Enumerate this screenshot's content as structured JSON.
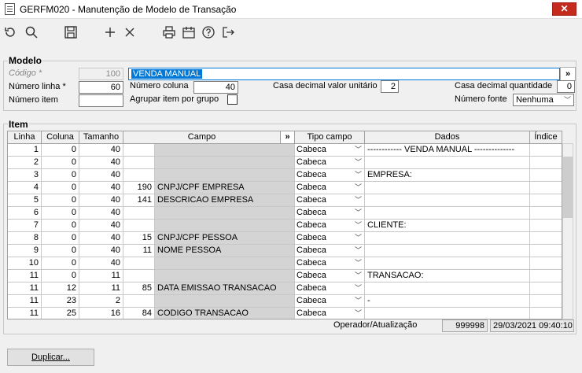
{
  "window": {
    "title": "GERFM020 - Manutenção de Modelo de Transação",
    "close_label": "✕"
  },
  "toolbar": {
    "icons": [
      "undo-icon",
      "search-icon",
      "save-icon",
      "add-icon",
      "delete-icon",
      "print-icon",
      "calendar-icon",
      "help-icon",
      "exit-icon"
    ]
  },
  "modelo": {
    "legend": "Modelo",
    "codigo_label": "Código *",
    "codigo_value": "100",
    "descricao_value": "VENDA MANUAL",
    "expand_label": "»",
    "numero_linha_label": "Número linha *",
    "numero_linha_value": "60",
    "numero_coluna_label": "Número coluna",
    "numero_coluna_value": "40",
    "casa_unitario_label": "Casa decimal valor unitário",
    "casa_unitario_value": "2",
    "casa_quantidade_label": "Casa decimal quantidade",
    "casa_quantidade_value": "0",
    "numero_item_label": "Número item",
    "numero_item_value": "",
    "agrupar_label": "Agrupar item por grupo",
    "agrupar_checked": false,
    "numero_fonte_label": "Número fonte",
    "numero_fonte_value": "Nenhuma"
  },
  "item": {
    "legend": "Item",
    "headers": {
      "linha": "Linha",
      "coluna": "Coluna",
      "tamanho": "Tamanho",
      "campo": "Campo",
      "expand": "»",
      "tipo": "Tipo campo",
      "dados": "Dados",
      "indice": "Índice"
    },
    "rows": [
      {
        "linha": "1",
        "coluna": "0",
        "tamanho": "40",
        "cod": "",
        "campo": "",
        "tipo": "Cabeca",
        "dados": "------------ VENDA MANUAL --------------",
        "indice": ""
      },
      {
        "linha": "2",
        "coluna": "0",
        "tamanho": "40",
        "cod": "",
        "campo": "",
        "tipo": "Cabeca",
        "dados": "",
        "indice": ""
      },
      {
        "linha": "3",
        "coluna": "0",
        "tamanho": "40",
        "cod": "",
        "campo": "",
        "tipo": "Cabeca",
        "dados": "EMPRESA:",
        "indice": ""
      },
      {
        "linha": "4",
        "coluna": "0",
        "tamanho": "40",
        "cod": "190",
        "campo": "CNPJ/CPF EMPRESA",
        "tipo": "Cabeca",
        "dados": "",
        "indice": ""
      },
      {
        "linha": "5",
        "coluna": "0",
        "tamanho": "40",
        "cod": "141",
        "campo": "DESCRICAO EMPRESA",
        "tipo": "Cabeca",
        "dados": "",
        "indice": ""
      },
      {
        "linha": "6",
        "coluna": "0",
        "tamanho": "40",
        "cod": "",
        "campo": "",
        "tipo": "Cabeca",
        "dados": "",
        "indice": ""
      },
      {
        "linha": "7",
        "coluna": "0",
        "tamanho": "40",
        "cod": "",
        "campo": "",
        "tipo": "Cabeca",
        "dados": "CLIENTE:",
        "indice": ""
      },
      {
        "linha": "8",
        "coluna": "0",
        "tamanho": "40",
        "cod": "15",
        "campo": "CNPJ/CPF PESSOA",
        "tipo": "Cabeca",
        "dados": "",
        "indice": ""
      },
      {
        "linha": "9",
        "coluna": "0",
        "tamanho": "40",
        "cod": "11",
        "campo": "NOME PESSOA",
        "tipo": "Cabeca",
        "dados": "",
        "indice": ""
      },
      {
        "linha": "10",
        "coluna": "0",
        "tamanho": "40",
        "cod": "",
        "campo": "",
        "tipo": "Cabeca",
        "dados": "",
        "indice": ""
      },
      {
        "linha": "11",
        "coluna": "0",
        "tamanho": "11",
        "cod": "",
        "campo": "",
        "tipo": "Cabeca",
        "dados": "TRANSACAO:",
        "indice": ""
      },
      {
        "linha": "11",
        "coluna": "12",
        "tamanho": "11",
        "cod": "85",
        "campo": "DATA EMISSAO TRANSACAO",
        "tipo": "Cabeca",
        "dados": "",
        "indice": ""
      },
      {
        "linha": "11",
        "coluna": "23",
        "tamanho": "2",
        "cod": "",
        "campo": "",
        "tipo": "Cabeca",
        "dados": "-",
        "indice": ""
      },
      {
        "linha": "11",
        "coluna": "25",
        "tamanho": "16",
        "cod": "84",
        "campo": "CODIGO TRANSACAO",
        "tipo": "Cabeca",
        "dados": "",
        "indice": ""
      }
    ]
  },
  "footer": {
    "operador_label": "Operador/Atualização",
    "operador_value": "999998",
    "data_value": "29/03/2021 09:40:10",
    "duplicar_label": "Duplicar..."
  }
}
